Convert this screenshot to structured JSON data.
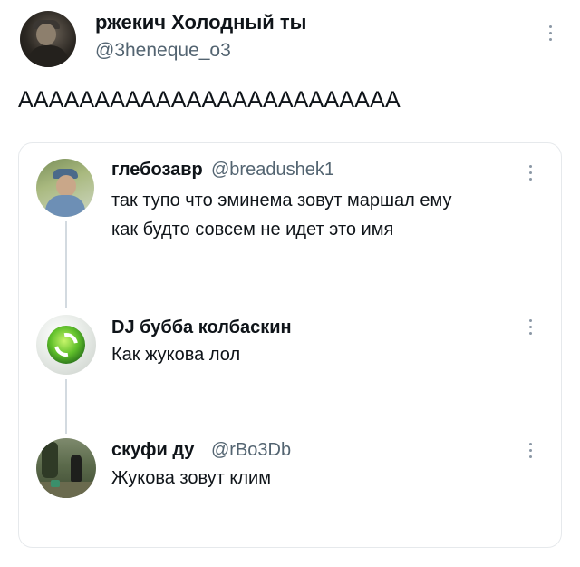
{
  "main_tweet": {
    "author_name": "ржекич Холодный ты",
    "author_handle": "@3heneque_o3",
    "text": "ААААААААААААААААААААААААА"
  },
  "quote_thread": [
    {
      "author_name": "глебозавр",
      "author_handle": "@breadushek1",
      "text_line1": "так тупо что эминема зовут маршал ему",
      "text_line2": "как будто совсем не идет это имя"
    },
    {
      "author_name": "DJ бубба колбаскин",
      "author_handle": "",
      "text": "Как жукова лол"
    },
    {
      "author_name": "скуфи ду",
      "author_handle": "@rBo3Db",
      "text": "Жукова зовут клим"
    }
  ],
  "icons": {
    "more": "more-vertical-icon"
  },
  "colors": {
    "text_primary": "#0f1419",
    "text_secondary": "#536471",
    "border": "#e6e9ec",
    "thread_line": "#d3dae0"
  }
}
